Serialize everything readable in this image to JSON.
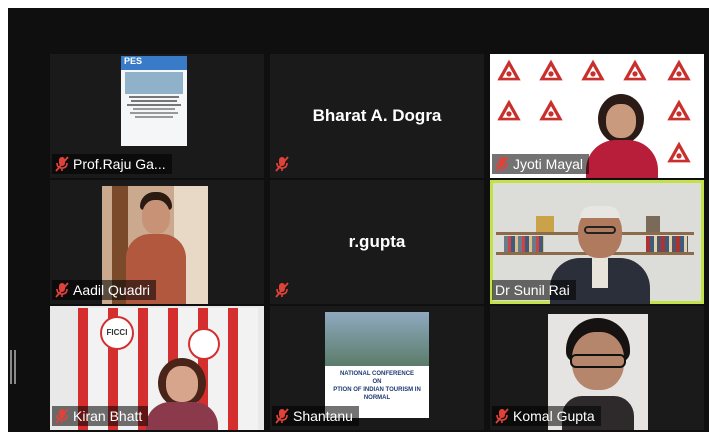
{
  "colors": {
    "stage_bg": "#0f0f0f",
    "tile_bg": "#1a1a1a",
    "active_speaker_border": "#c3e24a",
    "muted_mic": "#e0423a"
  },
  "participants": [
    {
      "name": "Prof.Raju Ga...",
      "muted": true,
      "view": "poster-slide"
    },
    {
      "name": "Bharat A. Dogra",
      "muted": true,
      "view": "name-only"
    },
    {
      "name": "Jyoti Mayal",
      "muted": true,
      "view": "video-logo-backdrop"
    },
    {
      "name": "Aadil Quadri",
      "muted": true,
      "view": "video"
    },
    {
      "name": "r.gupta",
      "muted": true,
      "view": "name-only"
    },
    {
      "name": "Dr Sunil Rai",
      "muted": false,
      "active_speaker": true,
      "view": "video-bookshelf"
    },
    {
      "name": "Kiran Bhatt",
      "muted": true,
      "view": "video-ficci-banner"
    },
    {
      "name": "Shantanu",
      "muted": true,
      "view": "conference-slide"
    },
    {
      "name": "Komal Gupta",
      "muted": true,
      "view": "video"
    }
  ],
  "slides": {
    "poster_heading": "PES",
    "conference_line1": "NATIONAL CONFERENCE",
    "conference_line2": "ON",
    "conference_line3": "PTION OF INDIAN TOURISM IN",
    "conference_line4": "NORMAL"
  },
  "banner_text": "FICCI"
}
